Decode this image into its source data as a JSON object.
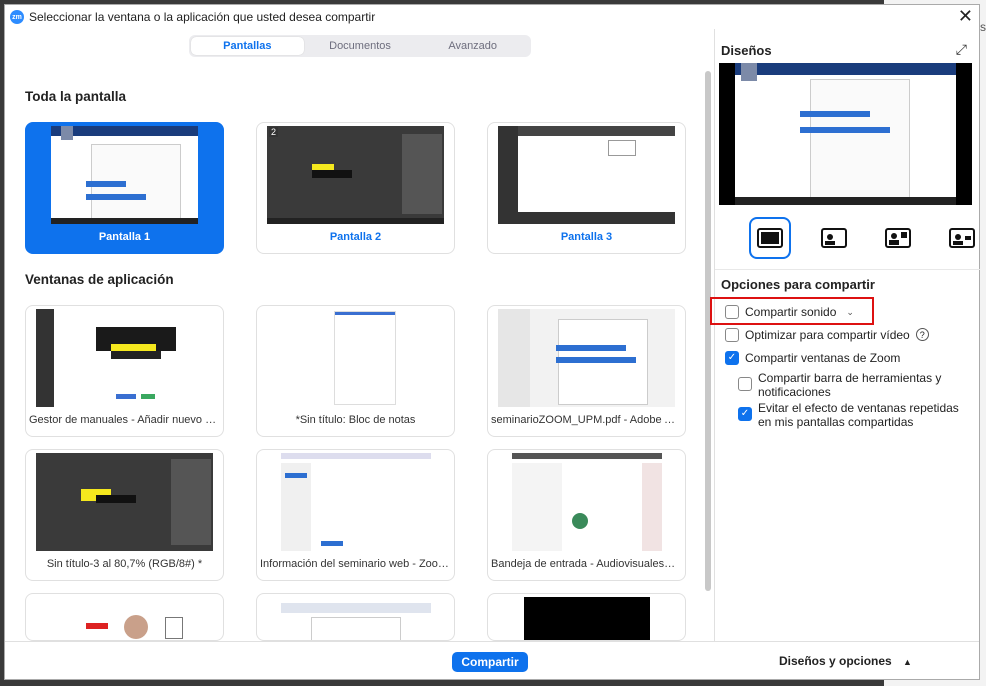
{
  "window": {
    "title": "Seleccionar la ventana o la aplicación que usted desea compartir",
    "app_badge": "zm",
    "close_glyph": "✕"
  },
  "tabs": [
    {
      "label": "Pantallas",
      "active": true
    },
    {
      "label": "Documentos",
      "active": false
    },
    {
      "label": "Avanzado",
      "active": false
    }
  ],
  "sections": {
    "screens_title": "Toda la pantalla",
    "apps_title": "Ventanas de aplicación"
  },
  "screens": [
    {
      "label": "Pantalla 1",
      "num": "1",
      "selected": true
    },
    {
      "label": "Pantalla 2",
      "num": "2",
      "selected": false
    },
    {
      "label": "Pantalla 3",
      "num": "3",
      "selected": false
    }
  ],
  "apps": [
    {
      "label": "Gestor de manuales - Añadir nuevo ma..."
    },
    {
      "label": "*Sin título: Bloc de notas"
    },
    {
      "label": "seminarioZOOM_UPM.pdf - Adobe Acr..."
    },
    {
      "label": "Sin título-3 al 80,7% (RGB/8#) *"
    },
    {
      "label": "Información del seminario web - Zoom..."
    },
    {
      "label": "Bandeja de entrada - AudiovisualesMail..."
    }
  ],
  "panel": {
    "layouts_title": "Diseños",
    "options_title": "Opciones para compartir",
    "options": {
      "sound": "Compartir sonido",
      "optimize": "Optimizar para compartir vídeo",
      "zoom_windows": "Compartir ventanas de Zoom",
      "toolbar": "Compartir barra de herramientas y notificaciones",
      "avoid": "Evitar el efecto de ventanas repetidas en mis pantallas compartidas"
    },
    "checked": {
      "sound": false,
      "optimize": false,
      "zoom_windows": true,
      "toolbar": false,
      "avoid": true
    }
  },
  "footer": {
    "share_label": "Compartir",
    "layouts_options_label": "Diseños y opciones",
    "caret": "▲"
  },
  "colors": {
    "accent": "#0e72ed",
    "highlight": "#dd1111"
  }
}
